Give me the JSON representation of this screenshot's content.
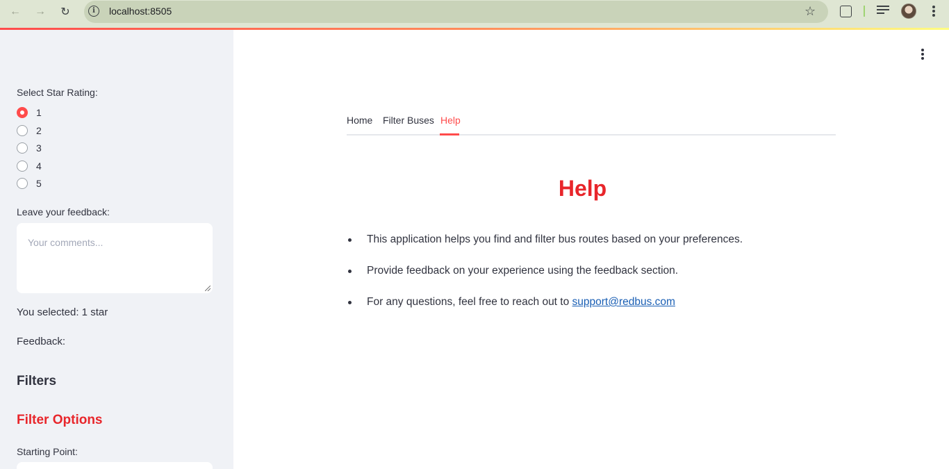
{
  "browser": {
    "url": "localhost:8505"
  },
  "sidebar": {
    "rating_label": "Select Star Rating:",
    "rating_options": [
      "1",
      "2",
      "3",
      "4",
      "5"
    ],
    "rating_selected": "1",
    "feedback_label": "Leave your feedback:",
    "feedback_placeholder": "Your comments...",
    "feedback_value": "",
    "selected_text": "You selected: 1 star",
    "feedback_text": "Feedback:",
    "filters_heading": "Filters",
    "filter_options_heading": "Filter Options",
    "starting_point_label": "Starting Point:"
  },
  "main": {
    "tabs": [
      {
        "label": "Home",
        "active": false
      },
      {
        "label": "Filter Buses",
        "active": false
      },
      {
        "label": "Help",
        "active": true
      }
    ],
    "title": "Help",
    "bullets": [
      {
        "text": "This application helps you find and filter bus routes based on your preferences."
      },
      {
        "text": "Provide feedback on your experience using the feedback section."
      },
      {
        "text": "For any questions, feel free to reach out to ",
        "link": "support@redbus.com"
      }
    ]
  },
  "colors": {
    "accent": "#ff4b4b",
    "heading_red": "#e8262b",
    "link": "#1a5fb4",
    "sidebar_bg": "#f0f2f6"
  }
}
